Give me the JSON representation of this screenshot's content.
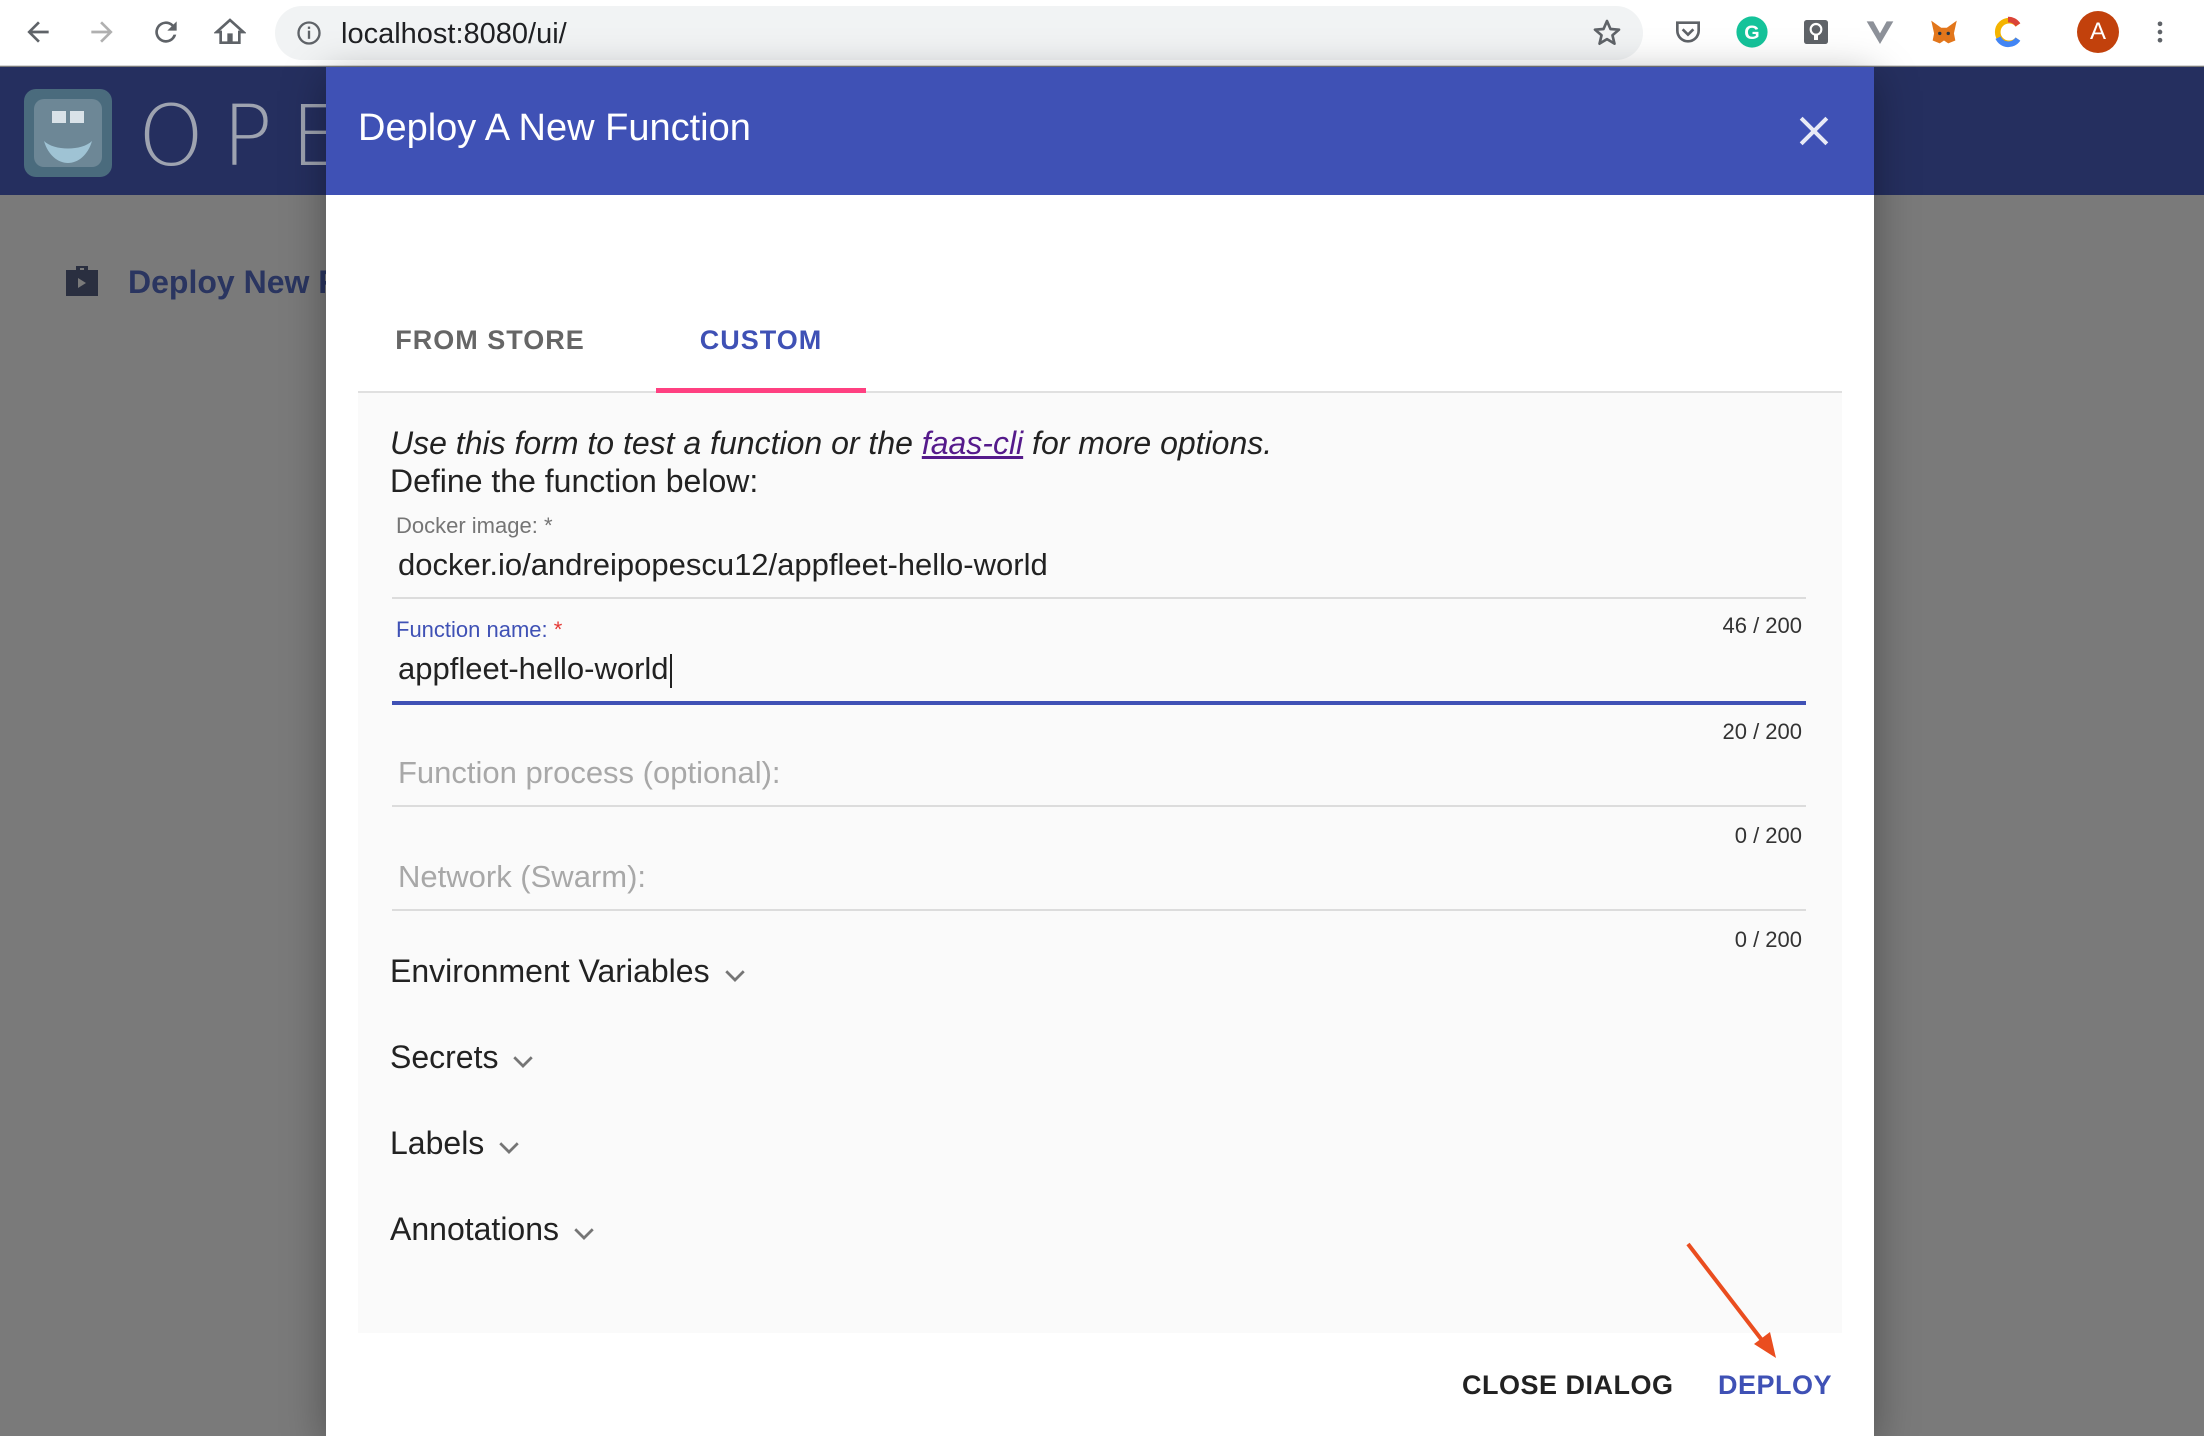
{
  "browser": {
    "url": "localhost:8080/ui/",
    "avatar_letter": "A",
    "icons": [
      "back-arrow-icon",
      "forward-arrow-icon",
      "reload-icon",
      "home-icon",
      "info-icon",
      "star-icon",
      "pocket-icon",
      "grammarly-icon",
      "lightbulb-icon",
      "vue-icon",
      "metamask-icon",
      "c-icon",
      "menu-dots-icon"
    ]
  },
  "background_app": {
    "brand": "OPEN",
    "sidebar_item": "Deploy New F"
  },
  "dialog": {
    "title": "Deploy A New Function",
    "tabs": [
      {
        "label": "FROM STORE",
        "active": false
      },
      {
        "label": "CUSTOM",
        "active": true
      }
    ],
    "intro": {
      "prefix": "Use this form to test a function or the ",
      "link": "faas-cli",
      "suffix": " for more options.",
      "line2": "Define the function below:"
    },
    "fields": {
      "docker_image": {
        "label": "Docker image:",
        "required": "*",
        "value": "docker.io/andreipopescu12/appfleet-hello-world",
        "counter": "46 / 200"
      },
      "function_name": {
        "label": "Function name:",
        "required": "*",
        "value": "appfleet-hello-world",
        "counter": "20 / 200"
      },
      "function_process": {
        "placeholder": "Function process (optional):",
        "counter": "0 / 200"
      },
      "network": {
        "placeholder": "Network (Swarm):",
        "counter": "0 / 200"
      }
    },
    "sections": [
      "Environment Variables",
      "Secrets",
      "Labels",
      "Annotations"
    ],
    "actions": {
      "close": "CLOSE DIALOG",
      "deploy": "DEPLOY"
    }
  },
  "colors": {
    "primary": "#3f51b5",
    "tab_indicator": "#ff4081",
    "annotation_arrow": "#ea4d1f",
    "overlay": "#7a7a7a"
  }
}
